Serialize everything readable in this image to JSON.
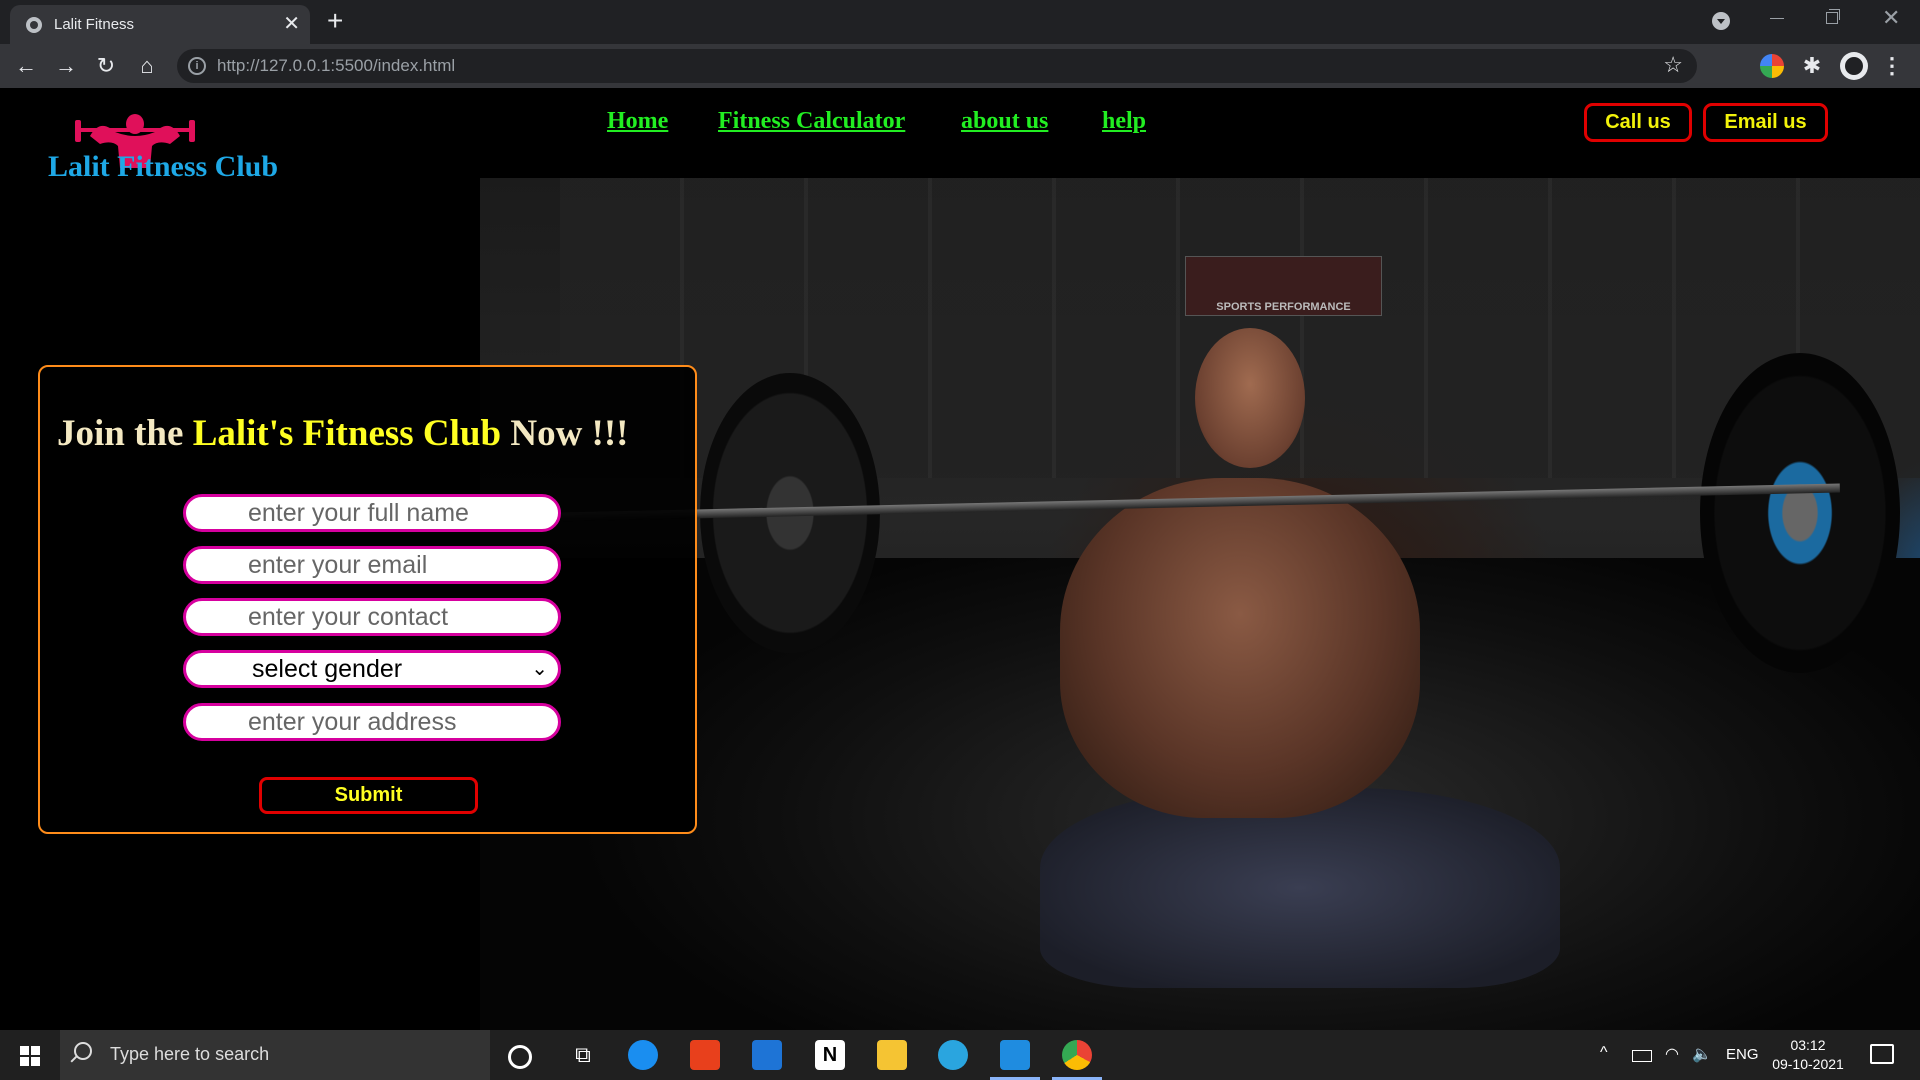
{
  "browser": {
    "tab_title": "Lalit Fitness",
    "tab_close": "✕",
    "new_tab": "+",
    "url": "http://127.0.0.1:5500/index.html",
    "nav_back": "←",
    "nav_forward": "→",
    "nav_reload": "↻",
    "nav_home": "⌂",
    "info_glyph": "i",
    "star": "☆",
    "extensions_glyph": "✱",
    "menu_glyph": "⋮",
    "window_close": "✕"
  },
  "page": {
    "site_name": "Lalit Fitness Club",
    "nav": [
      "Home",
      "Fitness Calculator",
      "about us",
      "help"
    ],
    "cta": {
      "call": "Call us",
      "email": "Email us"
    },
    "hero_sign": "SPORTS PERFORMANCE",
    "form": {
      "heading_pre": "Join the ",
      "heading_highlight": "Lalit's Fitness Club",
      "heading_post": " Now !!!",
      "name_placeholder": "enter your full name",
      "email_placeholder": "enter your email",
      "contact_placeholder": "enter your contact",
      "gender_selected": "select gender",
      "address_placeholder": "enter your address",
      "submit_label": "Submit"
    },
    "colors": {
      "nav_green": "#22ee22",
      "cta_border": "#e00000",
      "cta_text": "#f2f20a",
      "site_name": "#1ea8e6",
      "form_border": "#ff8c1a",
      "field_border": "#d6009e",
      "logo": "#e0105a"
    }
  },
  "taskbar": {
    "search_placeholder": "Type here to search",
    "taskview_glyph": "⧉",
    "notion_glyph": "N",
    "tray_up": "^",
    "wifi_glyph": "◠",
    "volume_glyph": "🔈",
    "language": "ENG",
    "time": "03:12",
    "date": "09-10-2021"
  }
}
